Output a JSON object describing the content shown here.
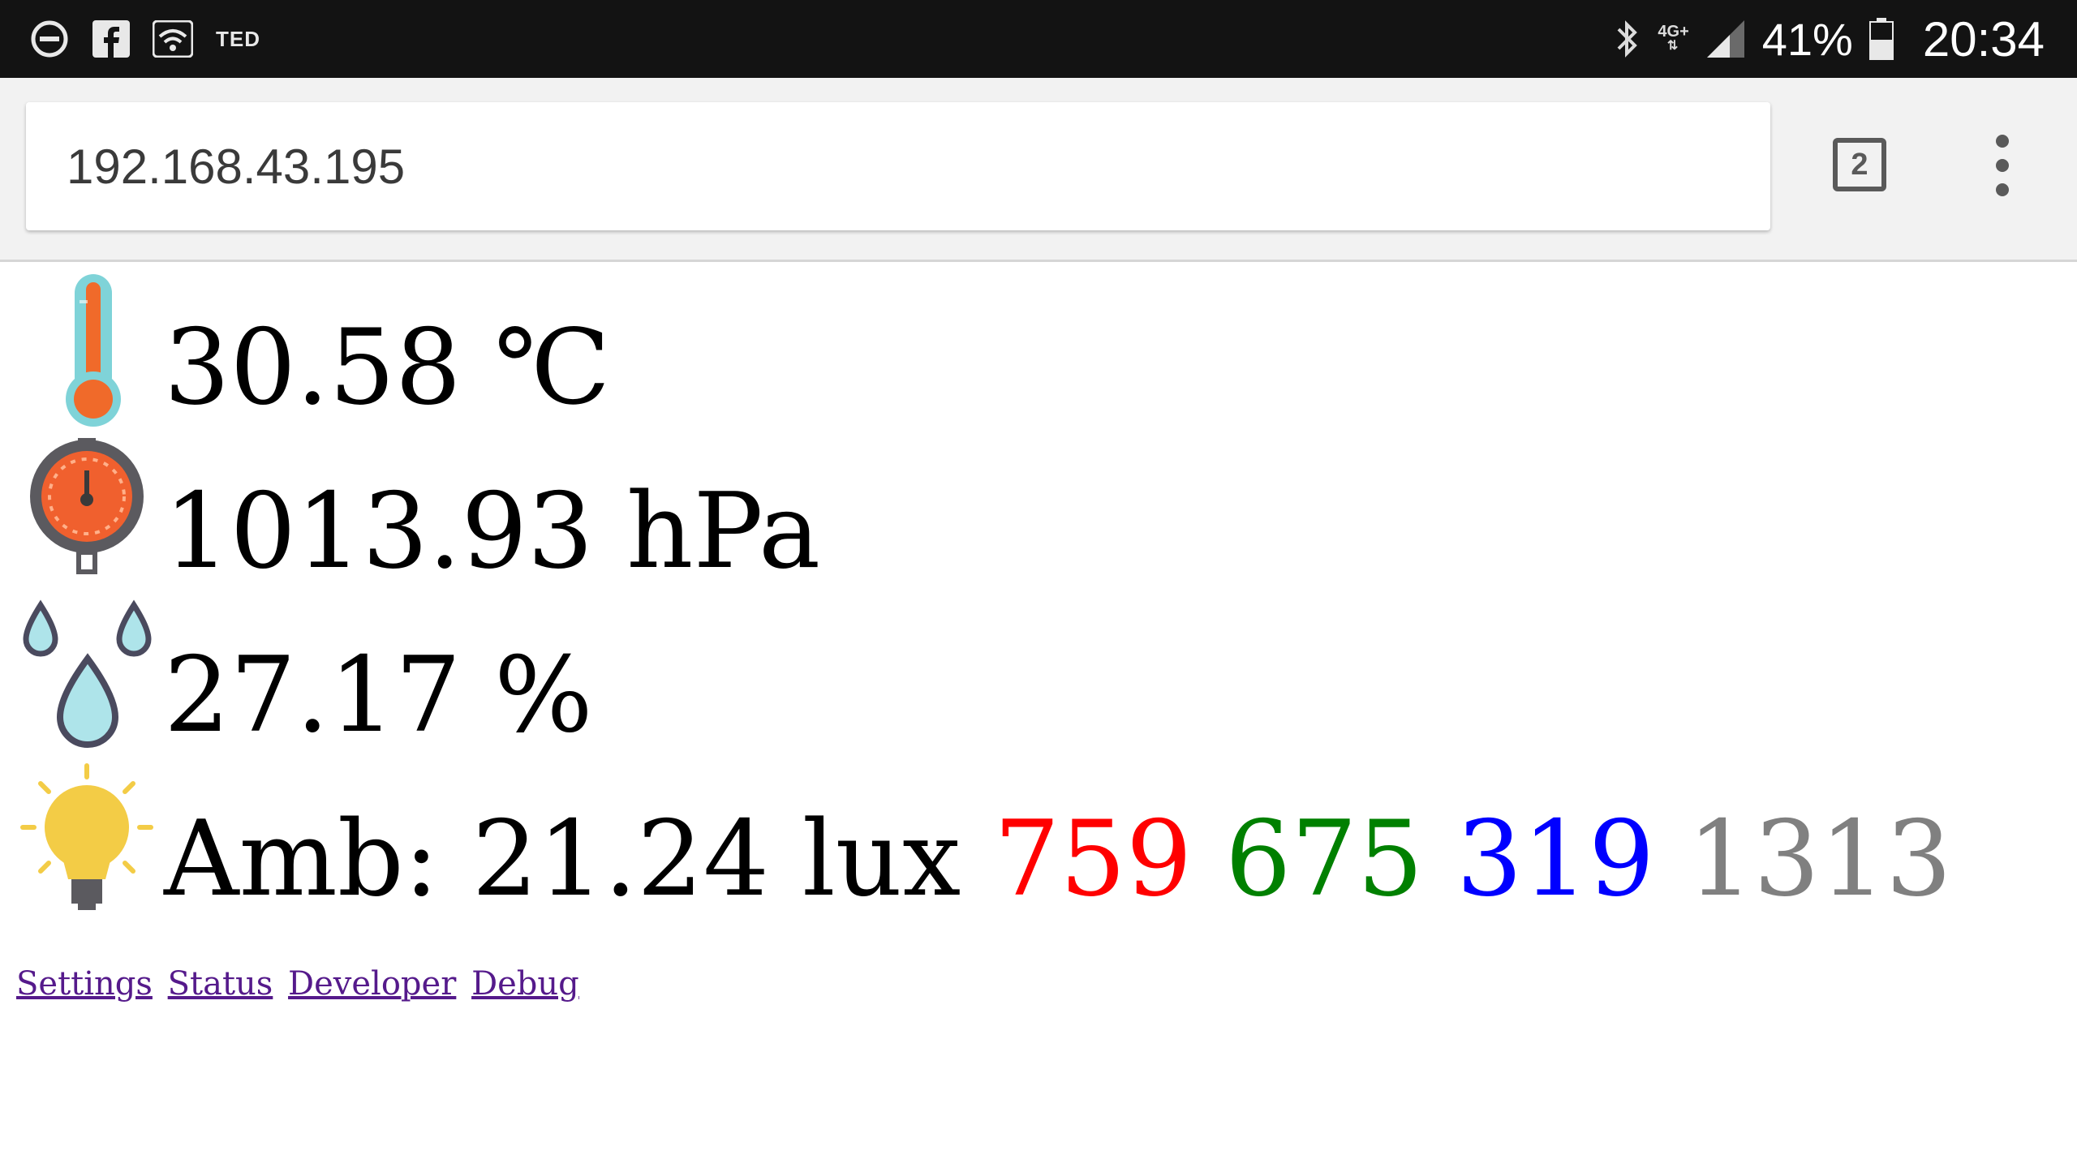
{
  "status_bar": {
    "notification_text": "TED",
    "network_type": "4G+",
    "battery_percent": "41%",
    "time": "20:34",
    "icons": [
      "do-not-disturb-icon",
      "facebook-icon",
      "wifi-icon",
      "bluetooth-icon",
      "signal-icon",
      "battery-icon"
    ]
  },
  "browser": {
    "url": "192.168.43.195",
    "tab_count": "2",
    "menu_icon": "more-vert-icon"
  },
  "readings": {
    "temperature": {
      "icon": "thermometer-icon",
      "text": "30.58 ℃"
    },
    "pressure": {
      "icon": "pressure-gauge-icon",
      "text": "1013.93 hPa"
    },
    "humidity": {
      "icon": "water-drops-icon",
      "text": "27.17 %"
    },
    "light": {
      "icon": "light-bulb-icon",
      "label": "Amb: 21.24 lux",
      "red": "759",
      "green": "675",
      "blue": "319",
      "clear": "1313"
    }
  },
  "colors": {
    "red": "#ff0000",
    "green": "#008000",
    "blue": "#0000ff",
    "clear": "#808080",
    "link": "#551a8b"
  },
  "links": [
    {
      "label": "Settings"
    },
    {
      "label": "Status"
    },
    {
      "label": "Developer"
    },
    {
      "label": "Debug"
    }
  ]
}
